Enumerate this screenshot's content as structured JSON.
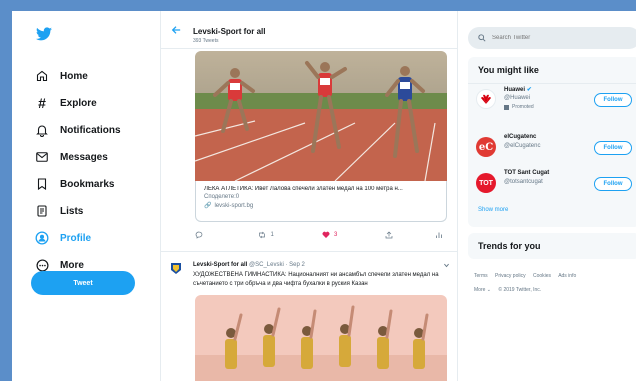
{
  "nav": {
    "items": [
      {
        "label": "Home",
        "icon": "home-icon"
      },
      {
        "label": "Explore",
        "icon": "hashtag-icon"
      },
      {
        "label": "Notifications",
        "icon": "bell-icon"
      },
      {
        "label": "Messages",
        "icon": "envelope-icon"
      },
      {
        "label": "Bookmarks",
        "icon": "bookmark-icon"
      },
      {
        "label": "Lists",
        "icon": "list-icon"
      },
      {
        "label": "Profile",
        "icon": "profile-icon"
      },
      {
        "label": "More",
        "icon": "more-icon"
      }
    ],
    "active": "Profile",
    "tweet_label": "Tweet"
  },
  "header": {
    "title": "Levski-Sport for all",
    "subtitle": "393 Tweets"
  },
  "tweet1": {
    "card_title": "ЛЕКА АТЛЕТИКА: Ивет Лалова спечели златен медал на 100 метра н...",
    "card_desc": "Споделете:0",
    "card_url": "levski-sport.bg",
    "replies": "",
    "retweets": "1",
    "likes": "3"
  },
  "tweet2": {
    "name": "Levski-Sport for all",
    "meta": "@SC_Levski · Sep 2",
    "text": "ХУДОЖЕСТВЕНА ГИМНАСТИКА: Националният ни ансамбъл спечели златен медал на съчетанието с три обръча и два чифта бухалки в руския Казан"
  },
  "search": {
    "placeholder": "Search Twitter"
  },
  "who_to_follow": {
    "title": "You might like",
    "accounts": [
      {
        "name": "Huawei",
        "handle": "@Huawei",
        "promoted": "Promoted",
        "follow": "Follow"
      },
      {
        "name": "elCugatenc",
        "handle": "@elCugatenc",
        "follow": "Follow"
      },
      {
        "name": "TOT Sant Cugat",
        "handle": "@totsantcugat",
        "follow": "Follow"
      }
    ],
    "show_more": "Show more"
  },
  "trends": {
    "title": "Trends for you"
  },
  "footer": {
    "links": [
      "Terms",
      "Privacy policy",
      "Cookies",
      "Ads info"
    ],
    "more": "More ⌄",
    "copyright": "© 2019 Twitter, Inc."
  },
  "colors": {
    "accent": "#1da1f2",
    "like": "#e0245e",
    "background": "#5b8ec9"
  }
}
